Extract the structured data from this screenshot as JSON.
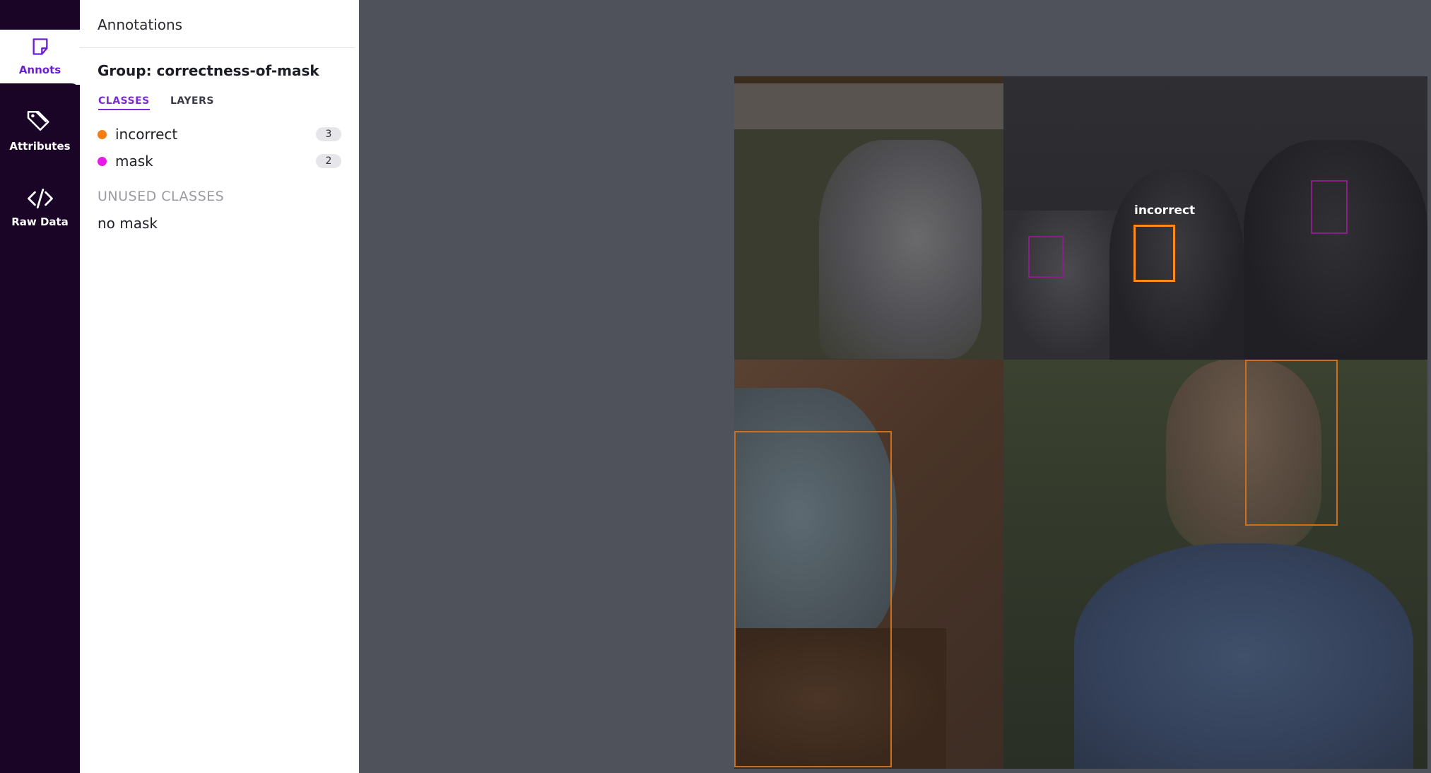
{
  "rail": {
    "items": [
      {
        "label": "Annots",
        "icon": "sticky-note-icon",
        "active": true
      },
      {
        "label": "Attributes",
        "icon": "tag-icon",
        "active": false
      },
      {
        "label": "Raw Data",
        "icon": "code-icon",
        "active": false
      }
    ]
  },
  "panel": {
    "title": "Annotations",
    "group_title": "Group: correctness-of-mask",
    "tabs": [
      {
        "label": "CLASSES",
        "active": true
      },
      {
        "label": "LAYERS",
        "active": false
      }
    ],
    "classes": [
      {
        "name": "incorrect",
        "count": "3",
        "color": "#f57c14"
      },
      {
        "name": "mask",
        "count": "2",
        "color": "#e61ae6"
      }
    ],
    "unused_title": "UNUSED CLASSES",
    "unused_classes": [
      "no mask"
    ]
  },
  "canvas": {
    "hover_label": "incorrect",
    "colors": {
      "incorrect": "#c9701e",
      "mask": "#8a1f8a",
      "highlight": "#ff8a1a"
    }
  }
}
